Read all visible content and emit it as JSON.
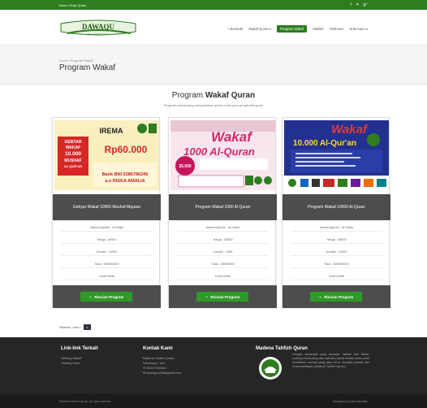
{
  "topbar": {
    "left_text": "Deeru Wuqf Quran",
    "social": [
      "f-icon",
      "twitter-icon",
      "google-plus-icon"
    ]
  },
  "logo": {
    "text": "DAWAQU",
    "tagline": "Dana Wakaf Quran"
  },
  "nav": [
    "Beranda",
    "Wakaf Quran ▾",
    "Program Wakaf",
    "Sekilah",
    "Testimoni",
    "Hubi Kayu ▾"
  ],
  "breadcrumb": {
    "home": "Home",
    "current": "Program Wakaf"
  },
  "page_title": "Program Wakaf",
  "section": {
    "title_plain": "Program ",
    "title_bold": "Wakaf Quran",
    "subtitle": "Program wakaf yang menyalurkan quran untuk para penghafal quran"
  },
  "cards": [
    {
      "title": "Gebyar Wakaf 10000 Mushaf Alquran",
      "nama": "Nama Alquran : Al Majid",
      "harga": "Harga : 60000",
      "jumlah": "Jumlah : 10000",
      "total": "Total : 600000000",
      "lihat": "Lihat Detail",
      "button": "Rincian Program",
      "poster": {
        "lines": [
          "GEBYAR",
          "WAKAF",
          "10.000",
          "MUSHAF",
          "AL-QUR'AN"
        ],
        "irema": "IREMA",
        "price": "Rp60.000",
        "bank": "Bank BNI 0286786245",
        "an": "a.n RISKA AMALIA"
      }
    },
    {
      "title": "Program Wakaf 1000 Al Quran",
      "nama": "Nama Alquran : Al Hufaz",
      "harga": "Harga : 35000",
      "jumlah": "Jumlah : 1000",
      "total": "Total : 35000000",
      "lihat": "Lihat Detail",
      "button": "Rincian Program",
      "poster": {
        "wakaf": "Wakaf",
        "quran": "1000 Al-Quran",
        "price": "35.000"
      }
    },
    {
      "title": "Program Wakaf 10000 Al Quran",
      "nama": "Nama Alquran : Al Hufaz",
      "harga": "Harga : 30000",
      "jumlah": "Jumlah : 10000",
      "total": "Total : 300000000",
      "lihat": "Lihat Detail",
      "button": "Rincian Program",
      "poster": {
        "wakaf": "Wakaf",
        "quran": "10.000 Al-Qur'an"
      }
    }
  ],
  "pager": {
    "label": "Halaman 1 dari 1",
    "page": "1"
  },
  "footer": {
    "links_title": "Link-link Terkait",
    "links": [
      "Tentang Wakaf",
      "Tentang Kami"
    ],
    "contact_title": "Kontak Kami",
    "contact": [
      "Madena Tahfizh Quran,",
      "Indramayu, Tuni",
      "",
      "✆ 082271933447",
      "✉ dawaqu.io99@gmail.com"
    ],
    "about_title": "Madena Tahfizh Quran",
    "about_text": "Dengan semangat yang amanah, kaltrak dan ikhlas, usahnya bersenang dan salurkan wakaf terbaik anda untuk membantu menhaf yang akan terus mengalir pahala dan kebermanfaatan (Madena Tahfizh Quran)"
  },
  "bottom": {
    "left": "Madena Tahfizh Quran. All right reserved",
    "right": "Designed by BoldGraphistic"
  },
  "colors": {
    "brand_green": "#2e7d1f",
    "button_green": "#2e9a27",
    "card_dark": "#4d4d4d",
    "footer": "#262626"
  }
}
